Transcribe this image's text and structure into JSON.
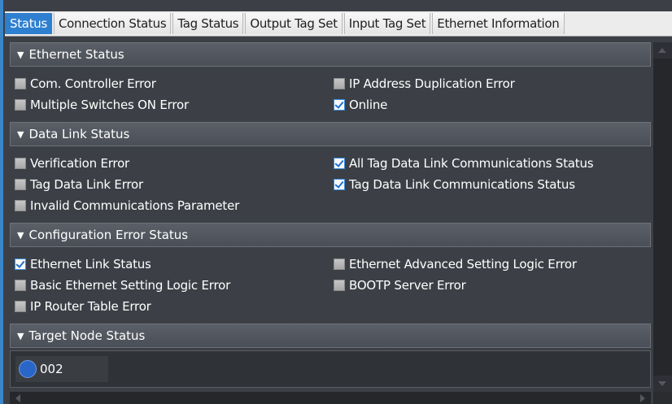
{
  "tabs": [
    {
      "label": "Status",
      "active": true
    },
    {
      "label": "Connection Status",
      "active": false
    },
    {
      "label": "Tag Status",
      "active": false
    },
    {
      "label": "Output Tag Set",
      "active": false
    },
    {
      "label": "Input Tag Set",
      "active": false
    },
    {
      "label": "Ethernet Information",
      "active": false
    }
  ],
  "sections": {
    "ethernet_status": {
      "title": "Ethernet Status",
      "items": [
        {
          "label": "Com. Controller Error",
          "checked": false
        },
        {
          "label": "IP Address Duplication Error",
          "checked": false
        },
        {
          "label": "Multiple Switches ON Error",
          "checked": false
        },
        {
          "label": "Online",
          "checked": true
        }
      ]
    },
    "data_link_status": {
      "title": "Data Link Status",
      "items": [
        {
          "label": "Verification Error",
          "checked": false
        },
        {
          "label": "All Tag Data Link Communications Status",
          "checked": true
        },
        {
          "label": "Tag Data Link Error",
          "checked": false
        },
        {
          "label": "Tag Data Link Communications Status",
          "checked": true
        },
        {
          "label": "Invalid Communications Parameter",
          "checked": false
        }
      ]
    },
    "configuration_error_status": {
      "title": "Configuration Error Status",
      "items": [
        {
          "label": "Ethernet Link Status",
          "checked": true
        },
        {
          "label": "Ethernet Advanced Setting Logic Error",
          "checked": false
        },
        {
          "label": "Basic Ethernet Setting Logic Error",
          "checked": false
        },
        {
          "label": "BOOTP Server Error",
          "checked": false
        },
        {
          "label": "IP Router Table Error",
          "checked": false
        }
      ]
    },
    "target_node_status": {
      "title": "Target Node Status",
      "nodes": [
        {
          "label": "002",
          "color": "#2a66c8"
        }
      ]
    }
  },
  "colors": {
    "accent": "#2f7fd0",
    "panel_background": "#3c4046",
    "check_blue": "#1f6fd0"
  },
  "icons": {
    "collapse": "triangle-down-icon",
    "checkbox": "checkbox-icon",
    "node": "circle-node-icon"
  }
}
